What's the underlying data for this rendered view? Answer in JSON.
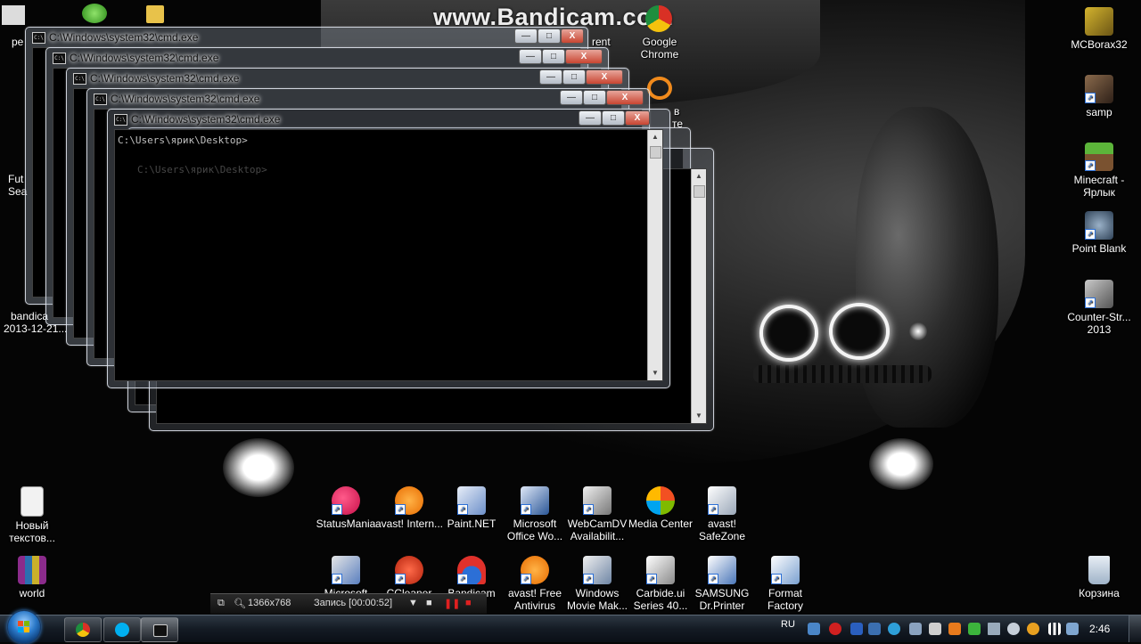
{
  "watermark": "www.Bandicam.com",
  "cmd_windows": [
    {
      "title": "C:\\Windows\\system32\\cmd.exe",
      "prompt": ""
    },
    {
      "title": "C:\\Windows\\system32\\cmd.exe",
      "prompt": ""
    },
    {
      "title": "C:\\Windows\\system32\\cmd.exe",
      "prompt": ""
    },
    {
      "title": "C:\\Windows\\system32\\cmd.exe",
      "prompt": ""
    },
    {
      "title": "C:\\Windows\\system32\\cmd.exe",
      "prompt": "C:\\Users\\ярик\\Desktop>"
    }
  ],
  "behind_prompt": "C:\\Users\\ярик\\Desktop>",
  "cmd_controls": {
    "minimize": "—",
    "maximize": "□",
    "close": "X"
  },
  "desktop_left_partials": {
    "p1": "pe",
    "p2": "Fut",
    "p3": "Sea",
    "p4": "bandica",
    "p5": "2013-12-21..."
  },
  "desktop_top_partials": {
    "google_chrome": "Google Chrome",
    "torrent_fragment": "rent",
    "frag_v": "в",
    "frag_te": "те"
  },
  "desktop_right_icons": [
    {
      "label": "MCBorax32"
    },
    {
      "label": "samp"
    },
    {
      "label": "Minecraft - Ярлык"
    },
    {
      "label": "Point Blank"
    },
    {
      "label": "Counter-Str... 2013"
    }
  ],
  "desktop_left_icons": [
    {
      "label": "Новый текстов..."
    },
    {
      "label": "world"
    }
  ],
  "desktop_row1_icons": [
    {
      "label": "StatusMania"
    },
    {
      "label": "avast! Intern..."
    },
    {
      "label": "Paint.NET"
    },
    {
      "label": "Microsoft Office Wo..."
    },
    {
      "label": "WebCamDV Availabilit..."
    },
    {
      "label": "Media Center"
    },
    {
      "label": "avast! SafeZone"
    }
  ],
  "desktop_row2_icons": [
    {
      "label": "Microsoft"
    },
    {
      "label": "CCleaner"
    },
    {
      "label": "Bandicam"
    },
    {
      "label": "avast! Free Antivirus"
    },
    {
      "label": "Windows Movie Mak..."
    },
    {
      "label": "Carbide.ui Series 40..."
    },
    {
      "label": "SAMSUNG Dr.Printer"
    },
    {
      "label": "Format Factory"
    }
  ],
  "recycle_bin": {
    "label": "Корзина"
  },
  "bandicam_bar": {
    "resolution": "1366x768",
    "record_label": "Запись [00:00:52]"
  },
  "taskbar": {
    "language": "RU",
    "clock": "2:46"
  },
  "colors": {
    "taskbar": "#141b24",
    "cmd_background": "#000000",
    "cmd_text": "#c0c0c0",
    "close_button": "#c84531",
    "start_orb": "#2a78c8"
  }
}
